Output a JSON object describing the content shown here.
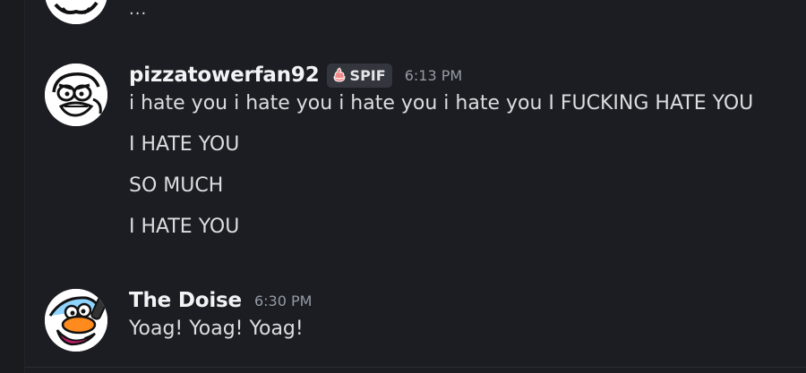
{
  "top_message": {
    "text": "..."
  },
  "messages": [
    {
      "username": "pizzatowerfan92",
      "tag": {
        "icon": "fire-cake-icon",
        "label": "SPIF"
      },
      "timestamp": "6:13 PM",
      "lines": [
        "i hate you i hate you i hate you i hate you I FUCKING HATE YOU",
        "I HATE YOU",
        "SO MUCH",
        "I HATE YOU"
      ]
    },
    {
      "username": "The Doise",
      "timestamp": "6:30 PM",
      "lines": [
        "Yoag! Yoag! Yoag!"
      ]
    }
  ],
  "colors": {
    "background": "#1c1d22",
    "text": "#dbdee1",
    "username": "#f2f3f5",
    "timestamp": "#949ba4",
    "tag_bg": "#34363d"
  }
}
